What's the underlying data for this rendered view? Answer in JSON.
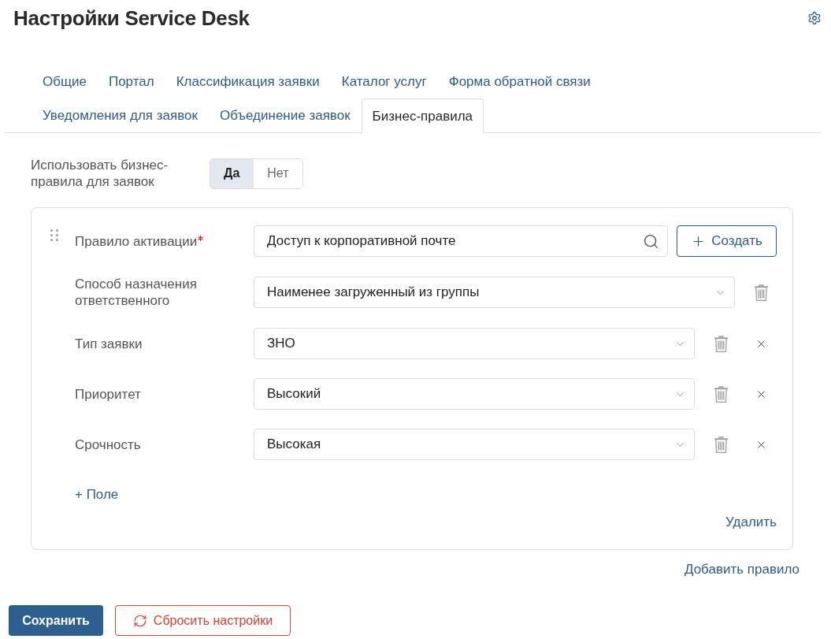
{
  "header": {
    "title": "Настройки Service Desk"
  },
  "tab_rows": [
    [
      {
        "label": "Общие",
        "selected": false
      },
      {
        "label": "Портал",
        "selected": false
      },
      {
        "label": "Классификация заявки",
        "selected": false
      },
      {
        "label": "Каталог услуг",
        "selected": false
      },
      {
        "label": "Форма обратной связи",
        "selected": false
      }
    ],
    [
      {
        "label": "Уведомления для заявок",
        "selected": false
      },
      {
        "label": "Объединение заявок",
        "selected": false
      },
      {
        "label": "Бизнес-правила",
        "selected": true
      }
    ]
  ],
  "business_rules": {
    "label": "Использовать бизнес-правила для заявок",
    "options": [
      {
        "label": "Да",
        "selected": true
      },
      {
        "label": "Нет",
        "selected": false
      }
    ]
  },
  "rule": {
    "fields": [
      {
        "kind": "search",
        "label": "Правило активации",
        "required": true,
        "value": "Доступ к корпоративной почте",
        "action": "Создать"
      },
      {
        "kind": "select",
        "label": "Способ назначения ответственного",
        "required": false,
        "value": "Наименее загруженный из группы",
        "removable": false
      },
      {
        "kind": "select",
        "label": "Тип заявки",
        "required": false,
        "value": "ЗНО",
        "removable": true
      },
      {
        "kind": "select",
        "label": "Приоритет",
        "required": false,
        "value": "Высокий",
        "removable": true
      },
      {
        "kind": "select",
        "label": "Срочность",
        "required": false,
        "value": "Высокая",
        "removable": true
      }
    ],
    "add_field": "+ Поле",
    "delete": "Удалить"
  },
  "add_rule": "Добавить правило",
  "footer": {
    "save": "Сохранить",
    "reset": "Сбросить настройки"
  }
}
